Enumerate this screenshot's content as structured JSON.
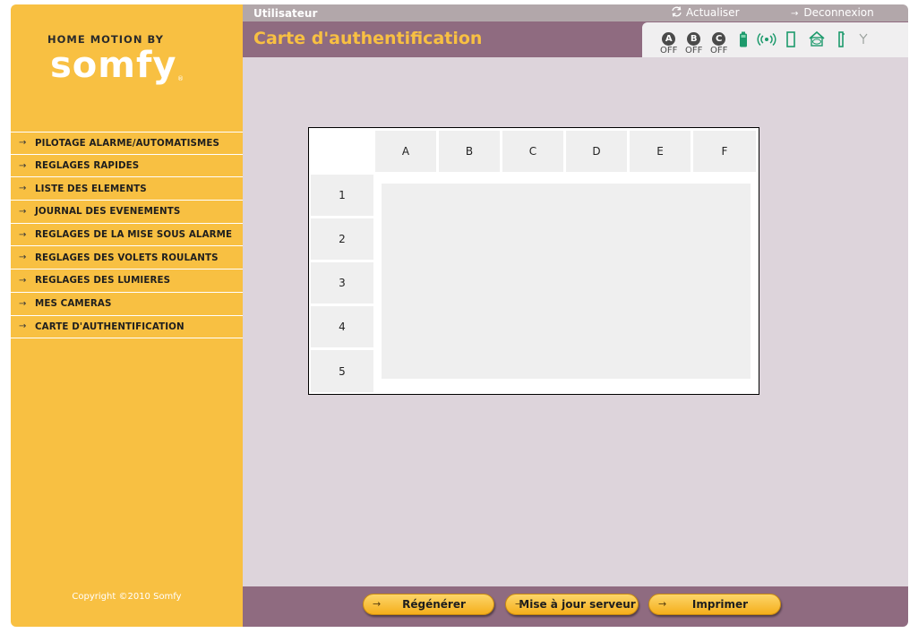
{
  "sidebar": {
    "logo_top": "HOME MOTION BY",
    "logo_brand": "somfy",
    "logo_registered": "®",
    "menu_arrow": "→",
    "items": [
      {
        "label": "PILOTAGE ALARME/AUTOMATISMES"
      },
      {
        "label": "REGLAGES RAPIDES"
      },
      {
        "label": "LISTE DES ELEMENTS"
      },
      {
        "label": "JOURNAL DES EVENEMENTS"
      },
      {
        "label": "REGLAGES DE LA MISE SOUS ALARME"
      },
      {
        "label": "REGLAGES DES VOLETS ROULANTS"
      },
      {
        "label": "REGLAGES DES LUMIERES"
      },
      {
        "label": "MES CAMERAS"
      },
      {
        "label": "CARTE D'AUTHENTIFICATION"
      }
    ],
    "copyright": "Copyright ©2010 Somfy"
  },
  "topbar": {
    "user": "Utilisateur",
    "refresh_label": "Actualiser",
    "logout_label": "Deconnexion",
    "logout_arrow": "→"
  },
  "header": {
    "title": "Carte d'authentification"
  },
  "status": {
    "zones": [
      {
        "letter": "A",
        "state": "OFF"
      },
      {
        "letter": "B",
        "state": "OFF"
      },
      {
        "letter": "C",
        "state": "OFF"
      }
    ],
    "icons": [
      "battery-icon",
      "radio-signal-icon",
      "door-open-icon",
      "house-ok-icon",
      "door-closed-icon",
      "antenna-icon"
    ],
    "icon_color": "#1d9a6c"
  },
  "auth_card": {
    "columns": [
      "A",
      "B",
      "C",
      "D",
      "E",
      "F"
    ],
    "rows": [
      "1",
      "2",
      "3",
      "4",
      "5"
    ]
  },
  "footer": {
    "arrow": "→",
    "buttons": [
      {
        "label": "Régénérer"
      },
      {
        "label": "Mise à jour serveur"
      },
      {
        "label": "Imprimer"
      }
    ]
  },
  "colors": {
    "sidebar": "#f8c042",
    "accent": "#8f6b80",
    "content": "#ddd4db"
  }
}
